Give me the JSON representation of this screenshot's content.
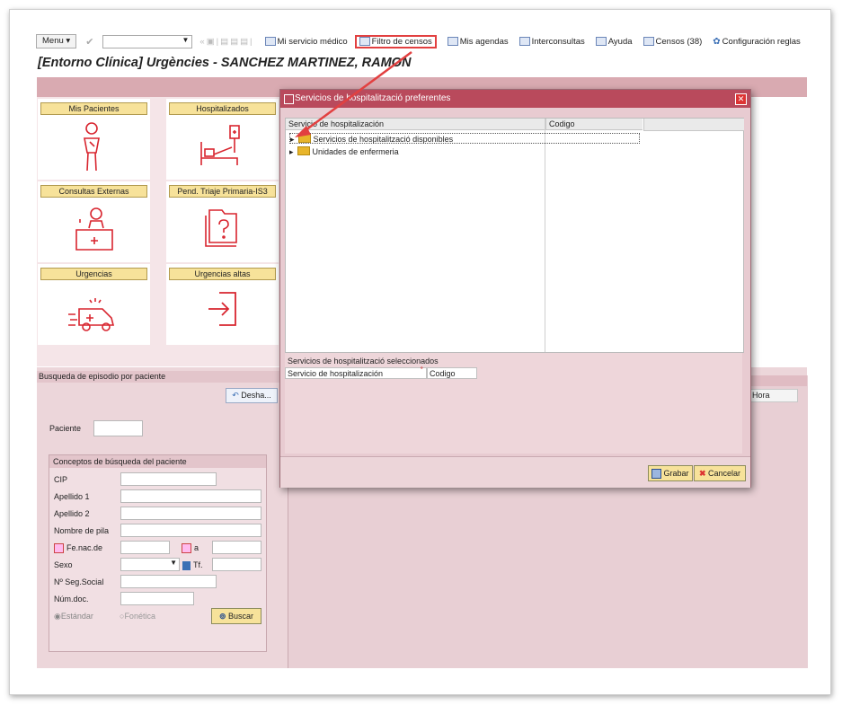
{
  "toolbar": {
    "menu_label": "Menu",
    "items": [
      {
        "label": "Mi servicio médico"
      },
      {
        "label": "Filtro de censos"
      },
      {
        "label": "Mis agendas"
      },
      {
        "label": "Interconsultas"
      },
      {
        "label": "Ayuda"
      },
      {
        "label": "Censos (38)"
      },
      {
        "label": "Configuración reglas"
      }
    ]
  },
  "header": {
    "title": "[Entorno Clínica] Urgències - SANCHEZ MARTINEZ, RAMON"
  },
  "tiles": [
    {
      "label": "Mis Pacientes",
      "icon": "patient-icon"
    },
    {
      "label": "Hospitalizados",
      "icon": "hospital-bed-icon"
    },
    {
      "label": "Consultas Externas",
      "icon": "doctor-desk-icon"
    },
    {
      "label": "Pend. Triaje Primaria-IS3",
      "icon": "question-folder-icon"
    },
    {
      "label": "Urgencias",
      "icon": "ambulance-icon"
    },
    {
      "label": "Urgencias altas",
      "icon": "exit-arrow-icon"
    }
  ],
  "search": {
    "header": "Busqueda de episodio por paciente",
    "desha_label": "Desha...",
    "paciente_label": "Paciente",
    "group_title": "Conceptos de búsqueda del paciente",
    "cip": "CIP",
    "apellido1": "Apellido 1",
    "apellido2": "Apellido 2",
    "nombre": "Nombre de pila",
    "fenac": "Fe.nac.de",
    "a": "a",
    "sexo": "Sexo",
    "tf": "Tf.",
    "nss": "Nº Seg.Social",
    "numdoc": "Núm.doc.",
    "estandar": "Estándar",
    "fonetica": "Fonética",
    "buscar": "Buscar"
  },
  "right": {
    "hora": "Hora"
  },
  "dialog": {
    "title": "Servicios de hospitalització preferentes",
    "col_service": "Servicio de hospitalización",
    "col_code": "Codigo",
    "nodes": [
      {
        "label": "Servicios de hospitalització disponibles"
      },
      {
        "label": "Unidades de enfermeria"
      }
    ],
    "selected_header": "Servicios de hospitalització seleccionados",
    "sel_col_service": "Servicio de hospitalización",
    "sel_col_code": "Codigo",
    "save": "Grabar",
    "cancel": "Cancelar"
  },
  "colors": {
    "accent": "#b94a5c",
    "button": "#f7e29a",
    "highlight": "#e24040",
    "icon": "#d8252f"
  }
}
